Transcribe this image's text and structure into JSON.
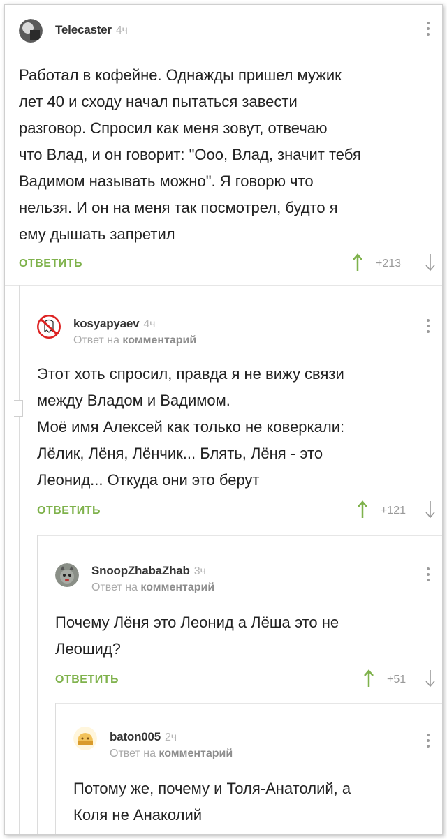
{
  "comments": [
    {
      "username": "Telecaster",
      "time": "4ч",
      "text": [
        "Работал в кофейне. Однажды пришел мужик",
        "лет 40 и сходу начал пытаться завести",
        "разговор. Спросил как меня зовут, отвечаю",
        "что Влад, и он говорит: \"Ооо, Влад, значит тебя",
        "Вадимом называть можно\". Я говорю что",
        "нельзя. И он на меня так посмотрел, будто я",
        "ему дышать запретил"
      ],
      "reply_label": "ОТВЕТИТЬ",
      "rating": "+213"
    },
    {
      "username": "kosyapyaev",
      "time": "4ч",
      "reply_to_prefix": "Ответ на",
      "reply_to_target": "комментарий",
      "text": [
        "Этот хоть спросил, правда я не вижу связи",
        "между Владом и Вадимом.",
        "Моё имя Алексей как только не коверкали:",
        "Лёлик, Лёня, Лёнчик... Блять, Лёня - это",
        "Леонид... Откуда они это берут"
      ],
      "reply_label": "ОТВЕТИТЬ",
      "rating": "+121"
    },
    {
      "username": "SnoopZhabaZhab",
      "time": "3ч",
      "reply_to_prefix": "Ответ на",
      "reply_to_target": "комментарий",
      "text": [
        "Почему Лёня это Леонид а Лёша это не",
        "Леошид?"
      ],
      "reply_label": "ОТВЕТИТЬ",
      "rating": "+51"
    },
    {
      "username": "baton005",
      "time": "2ч",
      "reply_to_prefix": "Ответ на",
      "reply_to_target": "комментарий",
      "text": [
        "Потому же, почему и Толя-Анатолий, а",
        "Коля не Анаколий"
      ]
    }
  ],
  "colors": {
    "accent_green": "#7fb24c",
    "muted_gray": "#9a9a9a"
  },
  "icons": [
    "user-avatar",
    "menu-dots-icon",
    "arrow-up-icon",
    "arrow-down-icon"
  ]
}
